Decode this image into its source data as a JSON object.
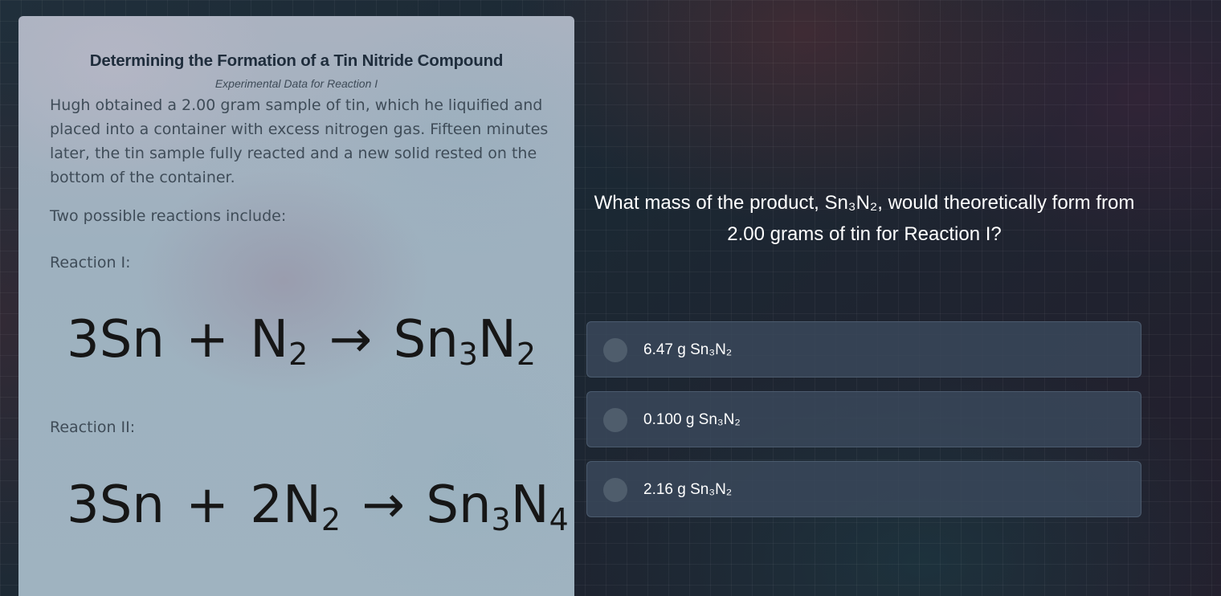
{
  "passage": {
    "title": "Determining the Formation of a Tin Nitride Compound",
    "subtitle": "Experimental Data for Reaction I",
    "body": "Hugh obtained a 2.00 gram sample of tin, which he liquified and placed into a container with excess nitrogen gas. Fifteen minutes later, the tin sample fully reacted and a new solid rested on the bottom of the container.",
    "intro": "Two possible reactions include:",
    "reaction_1": {
      "label": "Reaction I:",
      "left_a": "3Sn",
      "plus": "+",
      "left_b": "N",
      "left_b_sub": "2",
      "arrow": "→",
      "product": "Sn",
      "product_sub1": "3",
      "product_el2": "N",
      "product_sub2": "2"
    },
    "reaction_2": {
      "label": "Reaction II:",
      "left_a": "3Sn",
      "plus": "+",
      "left_b": "2N",
      "left_b_sub": "2",
      "arrow": "→",
      "product": "Sn",
      "product_sub1": "3",
      "product_el2": "N",
      "product_sub2": "4"
    }
  },
  "question": {
    "text": "What mass of the product, Sn₃N₂, would theoretically form from 2.00 grams of tin for Reaction I?"
  },
  "options": [
    {
      "label": "6.47 g Sn₃N₂"
    },
    {
      "label": "0.100 g Sn₃N₂"
    },
    {
      "label": "2.16 g Sn₃N₂"
    }
  ],
  "colors": {
    "card": "#9fb3c0",
    "option_bg": "#3a485a",
    "radio": "#4f5d6c",
    "question_text": "#ffffff"
  }
}
